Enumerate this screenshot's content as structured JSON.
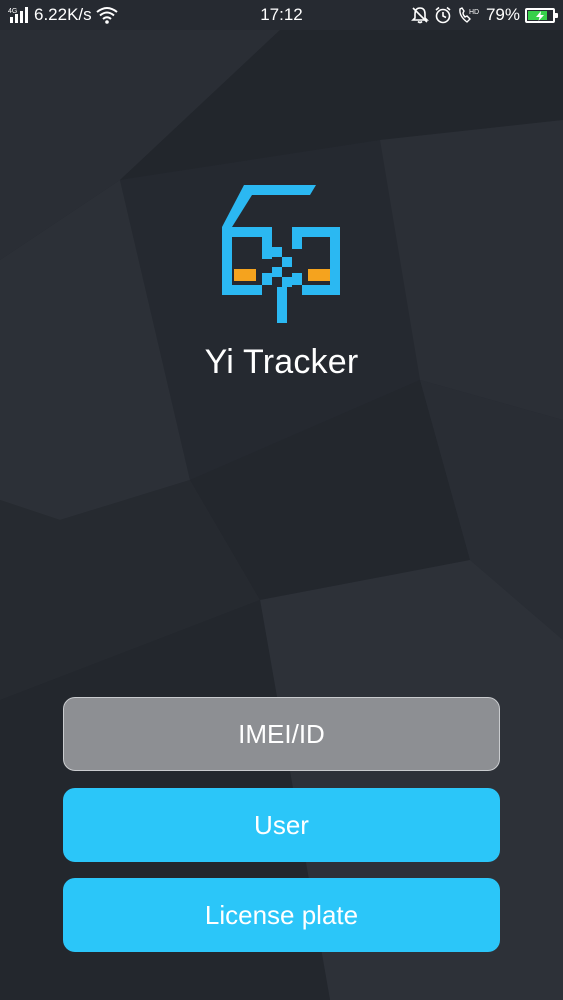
{
  "status_bar": {
    "network_label": "4G",
    "speed": "6.22K/s",
    "time": "17:12",
    "call_label": "HD",
    "battery_percent": "79%",
    "battery_level": 0.79,
    "battery_color": "#37d04a"
  },
  "app": {
    "title": "Yi Tracker"
  },
  "buttons": {
    "imei": "IMEI/ID",
    "user": "User",
    "license_plate": "License plate"
  },
  "colors": {
    "accent": "#2bc6f9",
    "logo_blue": "#2bb8f2",
    "logo_orange": "#f5a31e",
    "imei_button": "#8d8f93"
  }
}
